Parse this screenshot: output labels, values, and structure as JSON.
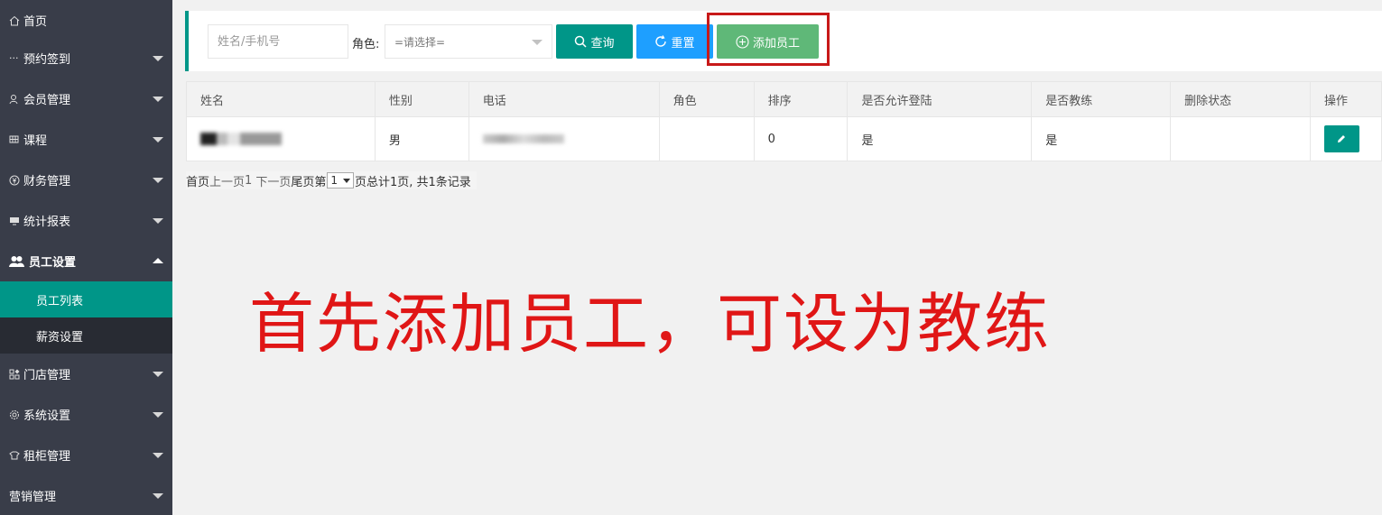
{
  "sidebar": {
    "items": [
      {
        "label": "首页",
        "icon": "home-icon"
      },
      {
        "label": "预约签到",
        "icon": "dots-icon"
      },
      {
        "label": "会员管理",
        "icon": "member-icon"
      },
      {
        "label": "课程",
        "icon": "grid-icon"
      },
      {
        "label": "财务管理",
        "icon": "yen-icon"
      },
      {
        "label": "统计报表",
        "icon": "chart-icon"
      },
      {
        "label": "员工设置",
        "icon": "staff-icon"
      },
      {
        "label": "门店管理",
        "icon": "store-icon"
      },
      {
        "label": "系统设置",
        "icon": "gear-icon"
      },
      {
        "label": "租柜管理",
        "icon": "locker-icon"
      },
      {
        "label": "营销管理",
        "icon": ""
      }
    ],
    "sub_items": [
      {
        "label": "员工列表",
        "active": true
      },
      {
        "label": "薪资设置",
        "active": false
      }
    ]
  },
  "toolbar": {
    "search_placeholder": "姓名/手机号",
    "role_label": "角色:",
    "role_value": "=请选择=",
    "query_label": "查询",
    "reset_label": "重置",
    "add_label": "添加员工"
  },
  "table": {
    "headers": [
      "姓名",
      "性别",
      "电话",
      "角色",
      "排序",
      "是否允许登陆",
      "是否教练",
      "删除状态",
      "操作"
    ],
    "rows": [
      {
        "gender": "男",
        "role": "",
        "sort": "0",
        "allow_login": "是",
        "is_coach": "是",
        "delete_status": ""
      }
    ]
  },
  "pager": {
    "first": "首页",
    "prev": "上一页",
    "current_link": "1",
    "next": "下一页",
    "last": "尾页",
    "goto_prefix": "第",
    "page_value": "1",
    "summary": "页总计1页, 共1条记录"
  },
  "annotation": "首先添加员工，可设为教练",
  "colors": {
    "sidebar_bg": "#393d49",
    "accent": "#009688",
    "reset_blue": "#1e9fff",
    "add_green": "#5fb878",
    "annotation_red": "#e01616"
  }
}
